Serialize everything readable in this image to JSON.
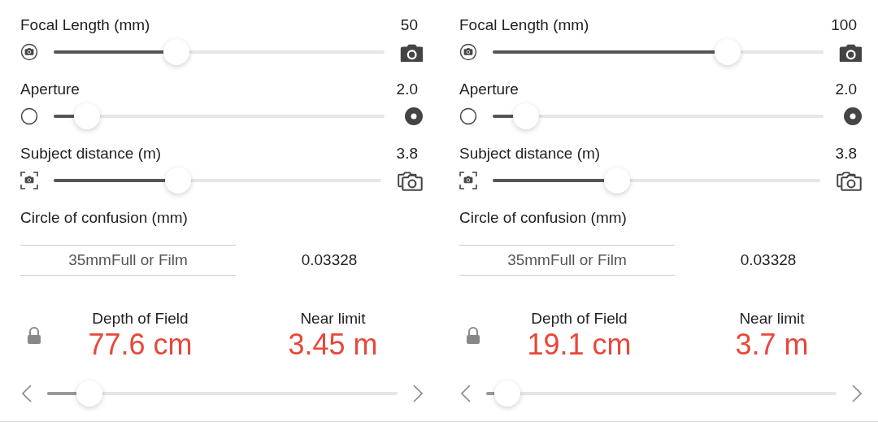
{
  "panels": [
    {
      "sliders": [
        {
          "kind": "focal",
          "label": "Focal Length (mm)",
          "value": "50",
          "level": 0.37
        },
        {
          "kind": "aperture",
          "label": "Aperture",
          "value": "2.0",
          "level": 0.1
        },
        {
          "kind": "distance",
          "label": "Subject distance (m)",
          "value": "3.8",
          "level": 0.38
        }
      ],
      "coc": {
        "label": "Circle of confusion (mm)",
        "picker": "35mmFull or Film",
        "value": "0.03328"
      },
      "results": [
        {
          "label": "Depth of Field",
          "value": "77.6 cm"
        },
        {
          "label": "Near limit",
          "value": "3.45 m"
        }
      ],
      "scrubber": {
        "level": 0.12
      }
    },
    {
      "sliders": [
        {
          "kind": "focal",
          "label": "Focal Length (mm)",
          "value": "100",
          "level": 0.71
        },
        {
          "kind": "aperture",
          "label": "Aperture",
          "value": "2.0",
          "level": 0.1
        },
        {
          "kind": "distance",
          "label": "Subject distance (m)",
          "value": "3.8",
          "level": 0.38
        }
      ],
      "coc": {
        "label": "Circle of confusion (mm)",
        "picker": "35mmFull or Film",
        "value": "0.03328"
      },
      "results": [
        {
          "label": "Depth of Field",
          "value": "19.1 cm"
        },
        {
          "label": "Near limit",
          "value": "3.7 m"
        }
      ],
      "scrubber": {
        "level": 0.06
      }
    }
  ]
}
